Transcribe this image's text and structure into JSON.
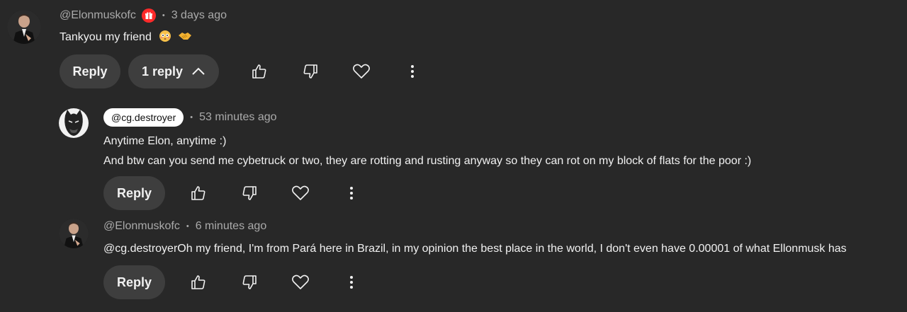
{
  "comments": [
    {
      "author": "@Elonmuskofc",
      "time": "3 days ago",
      "text": "Tankyou my friend",
      "reply_label": "Reply",
      "replies_label": "1 reply"
    },
    {
      "author": "@cg.destroyer",
      "time": "53 minutes ago",
      "text_line1": "Anytime Elon, anytime :)",
      "text_line2": "And btw can you send me cybetruck or two, they are rotting and rusting anyway so they can rot on my block of flats for the poor :)",
      "reply_label": "Reply"
    },
    {
      "author": "@Elonmuskofc",
      "time": "6 minutes ago",
      "text": "@cg.destroyerOh my friend, I'm from Pará here in Brazil, in my opinion the best place in the world, I don't even have 0.00001 of what Ellonmusk has",
      "reply_label": "Reply"
    }
  ],
  "separator": "•",
  "colors": {
    "background": "#282828",
    "pill": "#3e3e3e",
    "badge": "#ff2a2a",
    "meta": "#aaaaaa"
  },
  "icons": [
    "thumb-up-icon",
    "thumb-down-icon",
    "heart-icon",
    "more-vert-icon",
    "chevron-up-icon",
    "gift-icon",
    "flushed-face-emoji",
    "handshake-emoji"
  ]
}
